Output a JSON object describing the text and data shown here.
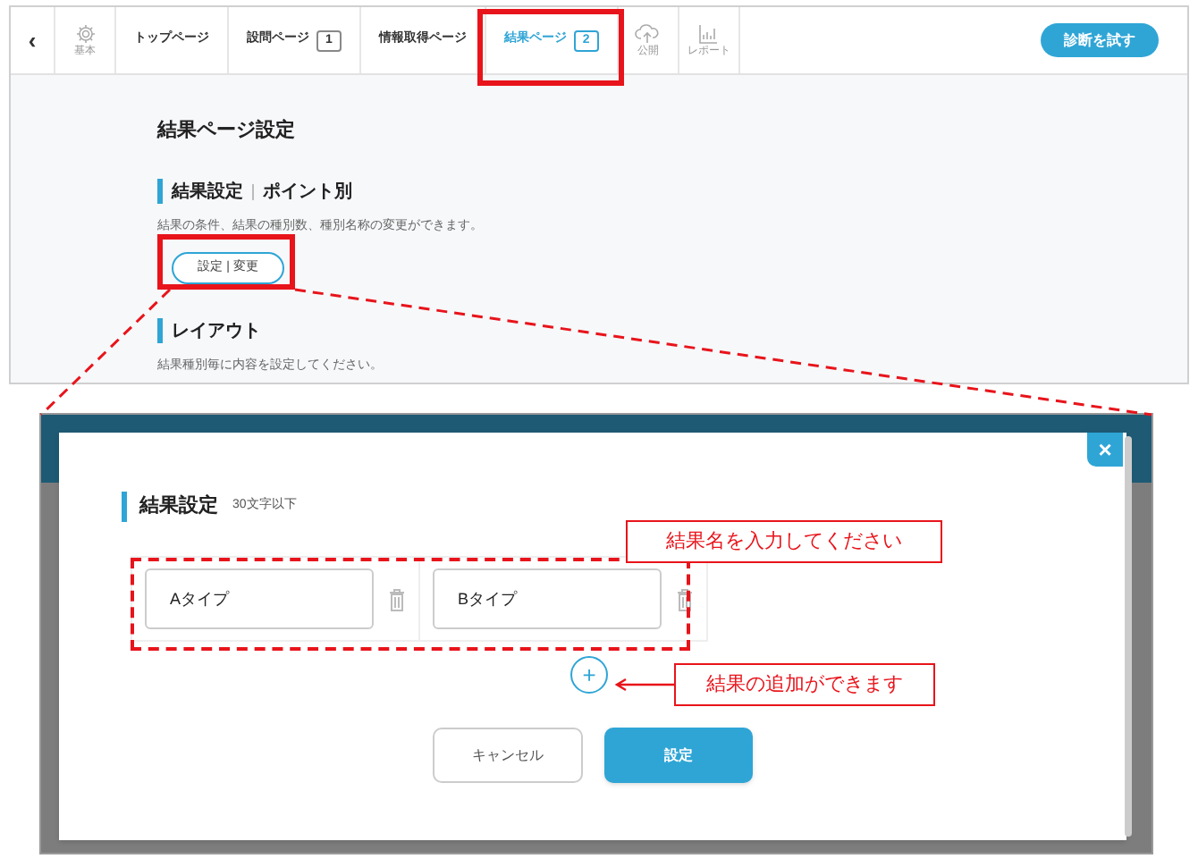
{
  "nav": {
    "back": "‹",
    "items": [
      {
        "kind": "icon",
        "label": "基本",
        "selected": false
      },
      {
        "kind": "page",
        "label": "トップページ",
        "selected": false
      },
      {
        "kind": "page",
        "label": "設問ページ",
        "count": "1",
        "selected": false
      },
      {
        "kind": "page",
        "label": "情報取得ページ",
        "selected": false
      },
      {
        "kind": "page",
        "label": "結果ページ",
        "count": "2",
        "selected": true
      },
      {
        "kind": "icon",
        "label": "公開",
        "selected": false
      },
      {
        "kind": "icon",
        "label": "レポート",
        "selected": false
      }
    ],
    "try_button": "診断を試す"
  },
  "content": {
    "title": "結果ページ設定",
    "sections": [
      {
        "heading": "結果設定",
        "subheading": "ポイント別",
        "description": "結果の条件、結果の種別数、種別名称の変更ができます。",
        "button": "設定 | 変更"
      },
      {
        "heading": "レイアウト",
        "description": "結果種別毎に内容を設定してください。"
      }
    ]
  },
  "modal": {
    "close": "×",
    "heading": "結果設定",
    "hint": "30文字以下",
    "results": [
      {
        "value": "Aタイプ"
      },
      {
        "value": "Bタイプ"
      }
    ],
    "add": "+",
    "cancel": "キャンセル",
    "submit": "設定"
  },
  "annotations": [
    {
      "text": "結果名を入力してください"
    },
    {
      "text": "結果の追加ができます"
    }
  ]
}
